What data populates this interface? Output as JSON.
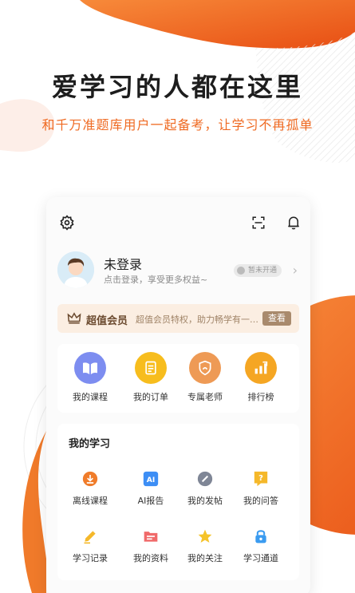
{
  "hero": {
    "title": "爱学习的人都在这里",
    "subtitle": "和千万准题库用户一起备考，让学习不再孤单"
  },
  "topbar": {
    "settings_icon": "settings-icon",
    "scan_icon": "scan-icon",
    "bell_icon": "bell-icon"
  },
  "profile": {
    "name": "未登录",
    "tip": "点击登录，享受更多权益~",
    "vip_status": "暂未开通"
  },
  "member": {
    "title": "超值会员",
    "desc": "超值会员特权，助力畅学有一…",
    "button": "查看"
  },
  "quick": [
    {
      "label": "我的课程",
      "icon": "book-icon",
      "color": "#7d8df0"
    },
    {
      "label": "我的订单",
      "icon": "order-icon",
      "color": "#f7bd1d"
    },
    {
      "label": "专属老师",
      "icon": "teacher-icon",
      "color": "#ee9a55"
    },
    {
      "label": "排行榜",
      "icon": "ranking-icon",
      "color": "#f5a623"
    }
  ],
  "study": {
    "title": "我的学习",
    "items": [
      {
        "label": "离线课程",
        "icon": "download-icon",
        "color": "#f07c2a"
      },
      {
        "label": "AI报告",
        "icon": "ai-report-icon",
        "color": "#3d8ef5"
      },
      {
        "label": "我的发帖",
        "icon": "post-icon",
        "color": "#7f8696"
      },
      {
        "label": "我的问答",
        "icon": "question-icon",
        "color": "#f5b82a"
      },
      {
        "label": "学习记录",
        "icon": "pencil-icon",
        "color": "#f5b82a"
      },
      {
        "label": "我的资料",
        "icon": "folder-icon",
        "color": "#f06a6a"
      },
      {
        "label": "我的关注",
        "icon": "star-icon",
        "color": "#f5c32a"
      },
      {
        "label": "学习通道",
        "icon": "lock-icon",
        "color": "#3a9bf0"
      }
    ]
  },
  "colors": {
    "brand_orange": "#ef6a22",
    "member_bg": "#fbeee2",
    "member_button": "#a98a6d"
  }
}
